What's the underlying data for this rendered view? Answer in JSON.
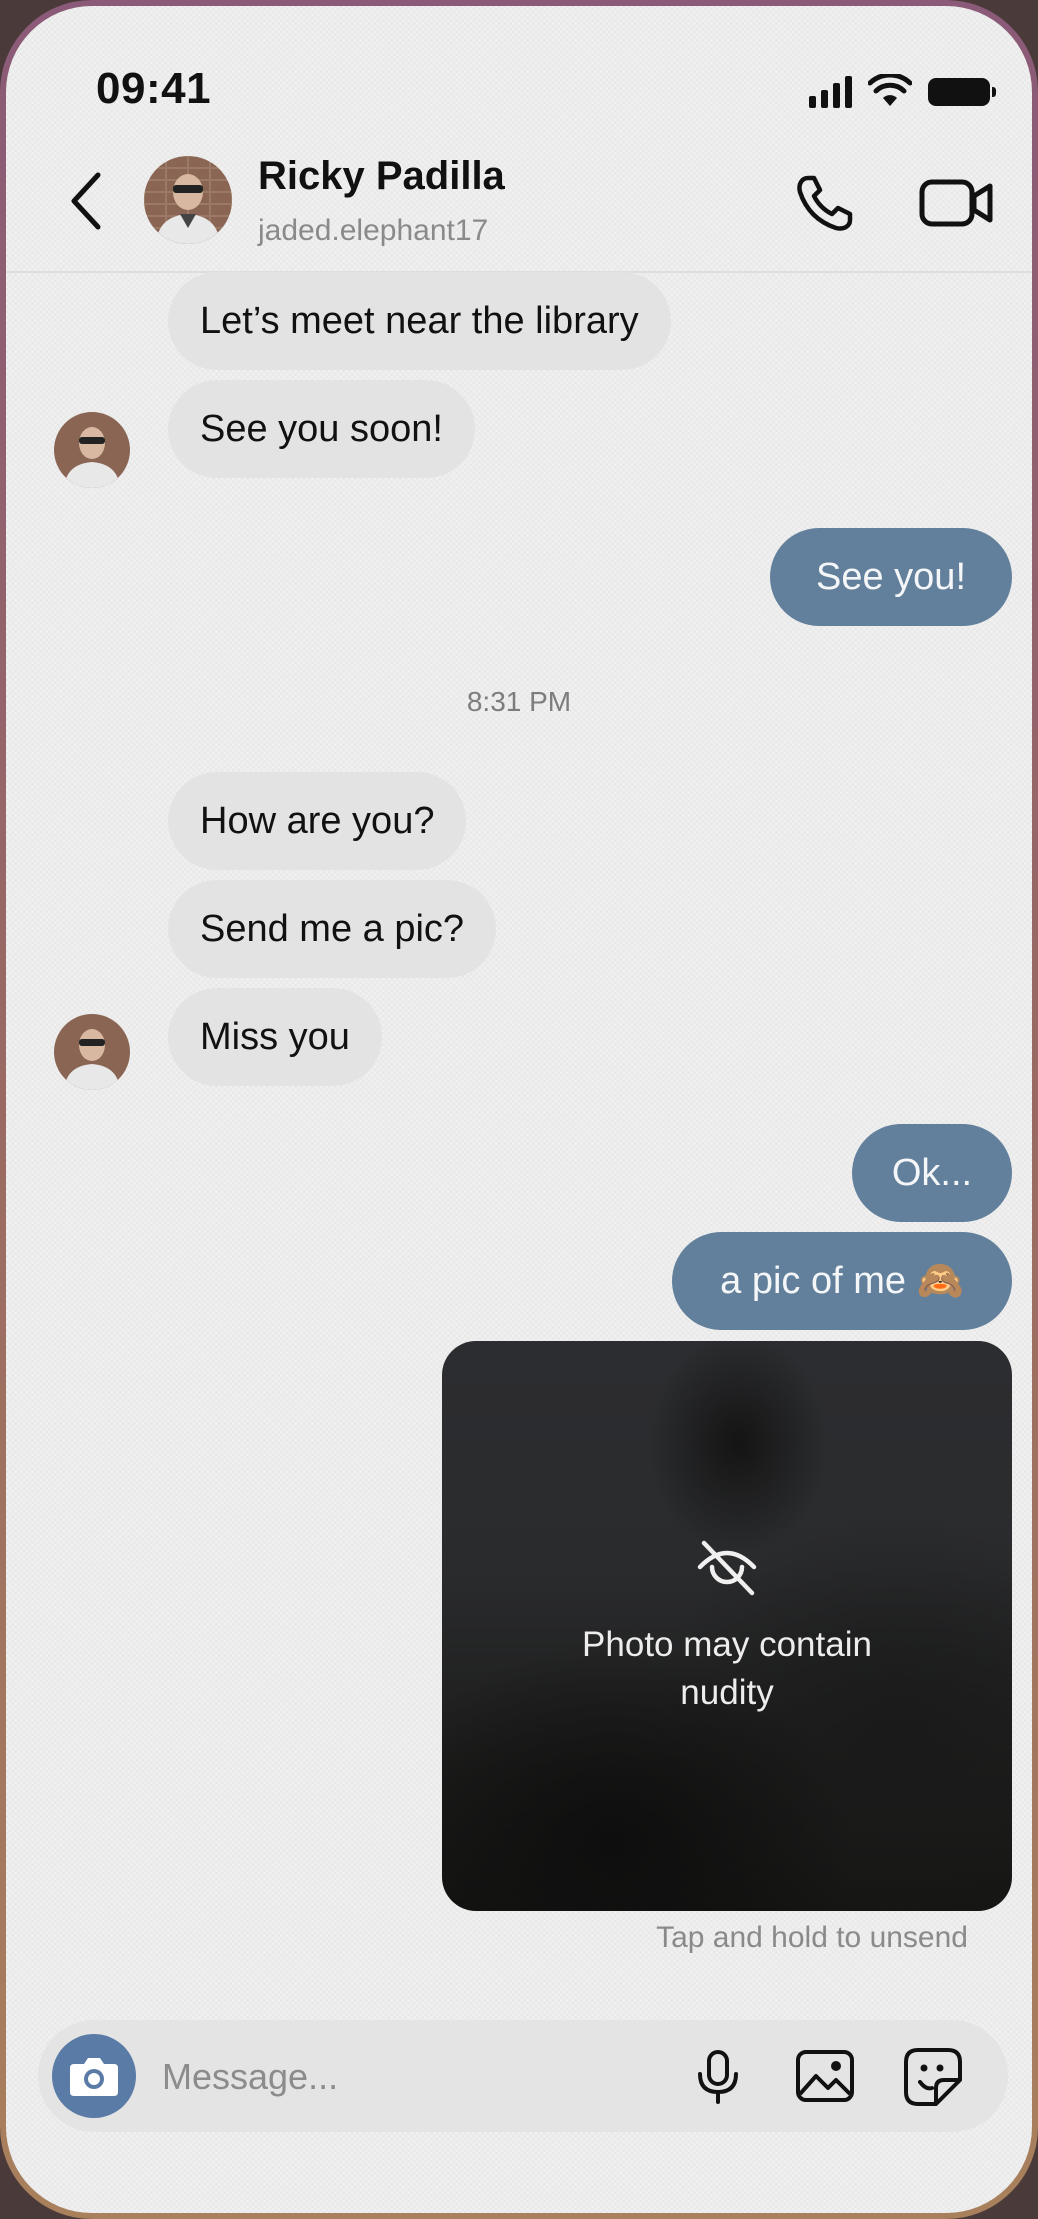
{
  "status_bar": {
    "time": "09:41",
    "icons": [
      "cellular-signal-icon",
      "wifi-icon",
      "battery-icon"
    ]
  },
  "header": {
    "name": "Ricky Padilla",
    "username": "jaded.elephant17",
    "icons": [
      "back-chevron-icon",
      "phone-icon",
      "video-camera-icon"
    ]
  },
  "messages": [
    {
      "side": "incoming",
      "text": "Let’s meet near the library"
    },
    {
      "side": "incoming",
      "text": "See you soon!"
    },
    {
      "side": "outgoing",
      "text": "See you!"
    },
    {
      "side": "incoming",
      "text": "How are you?"
    },
    {
      "side": "incoming",
      "text": "Send me a pic?"
    },
    {
      "side": "incoming",
      "text": "Miss you"
    },
    {
      "side": "outgoing",
      "text": "Ok..."
    },
    {
      "side": "outgoing",
      "text": "a pic of me 🙈"
    }
  ],
  "timestamp": "8:31 PM",
  "media": {
    "warning_line1": "Photo may contain",
    "warning_line2": "nudity",
    "icon": "eye-slash-icon"
  },
  "unsend_hint": "Tap and hold to unsend",
  "composer": {
    "placeholder": "Message...",
    "icons": [
      "camera-icon",
      "microphone-icon",
      "gallery-icon",
      "sticker-icon"
    ]
  },
  "colors": {
    "outgoing_bubble": "#62809c",
    "incoming_bubble": "#e3e3e3",
    "camera_button": "#5a7ba6",
    "background": "#f1f1f1"
  }
}
